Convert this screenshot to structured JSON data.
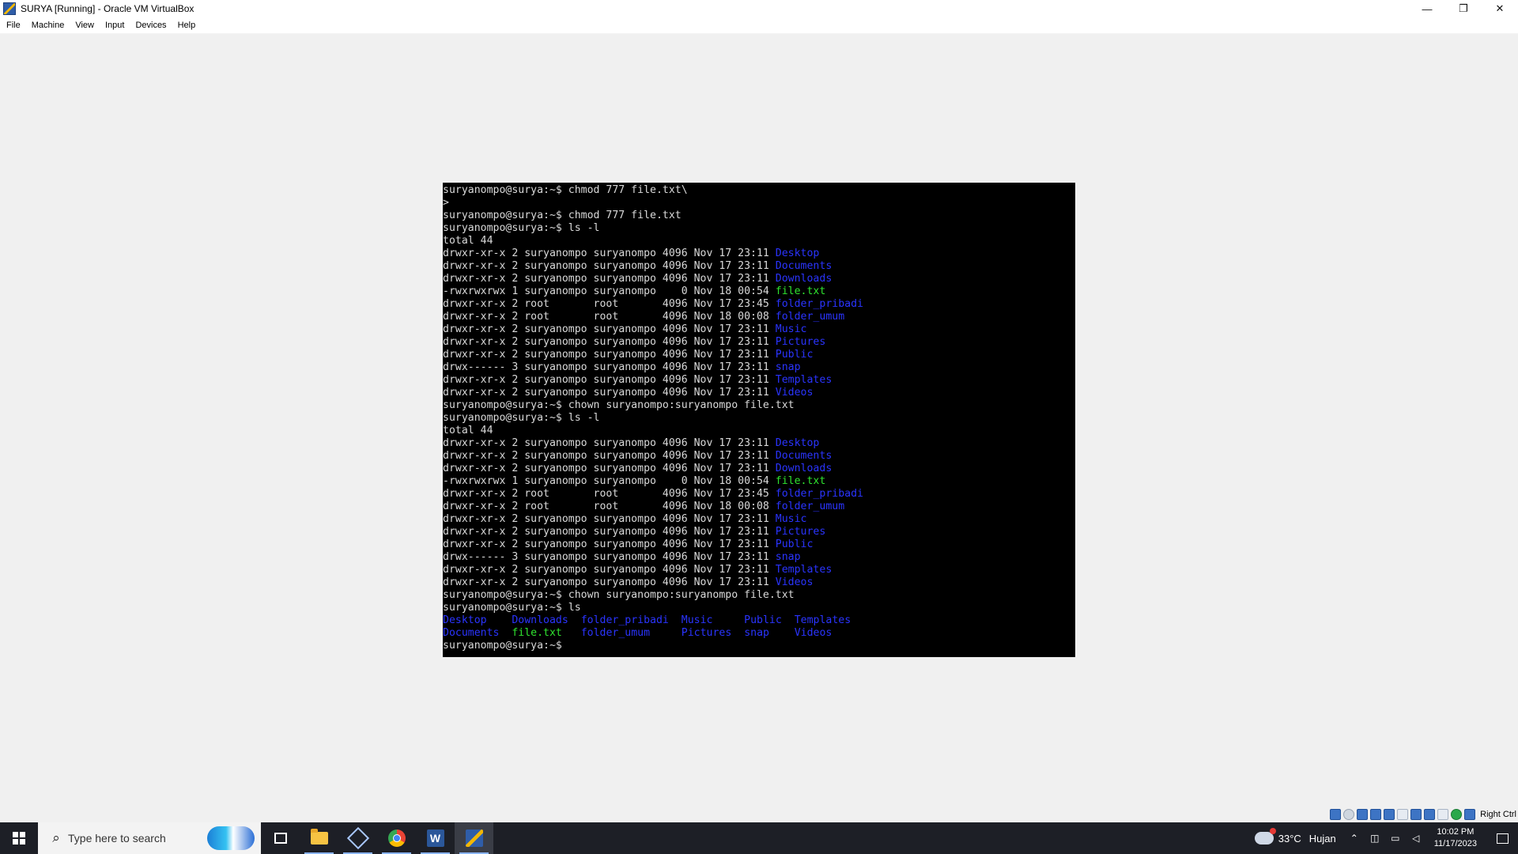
{
  "window": {
    "title": "SURYA [Running] - Oracle VM VirtualBox",
    "controls": {
      "minimize": "—",
      "restore": "❐",
      "close": "✕"
    }
  },
  "menu": [
    "File",
    "Machine",
    "View",
    "Input",
    "Devices",
    "Help"
  ],
  "terminal": {
    "lines": [
      [
        {
          "t": "suryanompo@surya:~$ chmod 777 file.txt\\"
        }
      ],
      [
        {
          "t": ">"
        }
      ],
      [
        {
          "t": "suryanompo@surya:~$ chmod 777 file.txt"
        }
      ],
      [
        {
          "t": "suryanompo@surya:~$ ls -l"
        }
      ],
      [
        {
          "t": "total 44"
        }
      ],
      [
        {
          "t": "drwxr-xr-x 2 suryanompo suryanompo 4096 Nov 17 23:11 "
        },
        {
          "t": "Desktop",
          "c": "dir"
        }
      ],
      [
        {
          "t": "drwxr-xr-x 2 suryanompo suryanompo 4096 Nov 17 23:11 "
        },
        {
          "t": "Documents",
          "c": "dir"
        }
      ],
      [
        {
          "t": "drwxr-xr-x 2 suryanompo suryanompo 4096 Nov 17 23:11 "
        },
        {
          "t": "Downloads",
          "c": "dir"
        }
      ],
      [
        {
          "t": "-rwxrwxrwx 1 suryanompo suryanompo    0 Nov 18 00:54 "
        },
        {
          "t": "file.txt",
          "c": "exec"
        }
      ],
      [
        {
          "t": "drwxr-xr-x 2 root       root       4096 Nov 17 23:45 "
        },
        {
          "t": "folder_pribadi",
          "c": "dir"
        }
      ],
      [
        {
          "t": "drwxr-xr-x 2 root       root       4096 Nov 18 00:08 "
        },
        {
          "t": "folder_umum",
          "c": "dir"
        }
      ],
      [
        {
          "t": "drwxr-xr-x 2 suryanompo suryanompo 4096 Nov 17 23:11 "
        },
        {
          "t": "Music",
          "c": "dir"
        }
      ],
      [
        {
          "t": "drwxr-xr-x 2 suryanompo suryanompo 4096 Nov 17 23:11 "
        },
        {
          "t": "Pictures",
          "c": "dir"
        }
      ],
      [
        {
          "t": "drwxr-xr-x 2 suryanompo suryanompo 4096 Nov 17 23:11 "
        },
        {
          "t": "Public",
          "c": "dir"
        }
      ],
      [
        {
          "t": "drwx------ 3 suryanompo suryanompo 4096 Nov 17 23:11 "
        },
        {
          "t": "snap",
          "c": "dir"
        }
      ],
      [
        {
          "t": "drwxr-xr-x 2 suryanompo suryanompo 4096 Nov 17 23:11 "
        },
        {
          "t": "Templates",
          "c": "dir"
        }
      ],
      [
        {
          "t": "drwxr-xr-x 2 suryanompo suryanompo 4096 Nov 17 23:11 "
        },
        {
          "t": "Videos",
          "c": "dir"
        }
      ],
      [
        {
          "t": "suryanompo@surya:~$ chown suryanompo:suryanompo file.txt"
        }
      ],
      [
        {
          "t": "suryanompo@surya:~$ ls -l"
        }
      ],
      [
        {
          "t": "total 44"
        }
      ],
      [
        {
          "t": "drwxr-xr-x 2 suryanompo suryanompo 4096 Nov 17 23:11 "
        },
        {
          "t": "Desktop",
          "c": "dir"
        }
      ],
      [
        {
          "t": "drwxr-xr-x 2 suryanompo suryanompo 4096 Nov 17 23:11 "
        },
        {
          "t": "Documents",
          "c": "dir"
        }
      ],
      [
        {
          "t": "drwxr-xr-x 2 suryanompo suryanompo 4096 Nov 17 23:11 "
        },
        {
          "t": "Downloads",
          "c": "dir"
        }
      ],
      [
        {
          "t": "-rwxrwxrwx 1 suryanompo suryanompo    0 Nov 18 00:54 "
        },
        {
          "t": "file.txt",
          "c": "exec"
        }
      ],
      [
        {
          "t": "drwxr-xr-x 2 root       root       4096 Nov 17 23:45 "
        },
        {
          "t": "folder_pribadi",
          "c": "dir"
        }
      ],
      [
        {
          "t": "drwxr-xr-x 2 root       root       4096 Nov 18 00:08 "
        },
        {
          "t": "folder_umum",
          "c": "dir"
        }
      ],
      [
        {
          "t": "drwxr-xr-x 2 suryanompo suryanompo 4096 Nov 17 23:11 "
        },
        {
          "t": "Music",
          "c": "dir"
        }
      ],
      [
        {
          "t": "drwxr-xr-x 2 suryanompo suryanompo 4096 Nov 17 23:11 "
        },
        {
          "t": "Pictures",
          "c": "dir"
        }
      ],
      [
        {
          "t": "drwxr-xr-x 2 suryanompo suryanompo 4096 Nov 17 23:11 "
        },
        {
          "t": "Public",
          "c": "dir"
        }
      ],
      [
        {
          "t": "drwx------ 3 suryanompo suryanompo 4096 Nov 17 23:11 "
        },
        {
          "t": "snap",
          "c": "dir"
        }
      ],
      [
        {
          "t": "drwxr-xr-x 2 suryanompo suryanompo 4096 Nov 17 23:11 "
        },
        {
          "t": "Templates",
          "c": "dir"
        }
      ],
      [
        {
          "t": "drwxr-xr-x 2 suryanompo suryanompo 4096 Nov 17 23:11 "
        },
        {
          "t": "Videos",
          "c": "dir"
        }
      ],
      [
        {
          "t": "suryanompo@surya:~$ chown suryanompo:suryanompo file.txt"
        }
      ],
      [
        {
          "t": "suryanompo@surya:~$ ls"
        }
      ],
      [
        {
          "t": "Desktop",
          "c": "dir"
        },
        {
          "t": "    "
        },
        {
          "t": "Downloads",
          "c": "dir"
        },
        {
          "t": "  "
        },
        {
          "t": "folder_pribadi",
          "c": "dir"
        },
        {
          "t": "  "
        },
        {
          "t": "Music",
          "c": "dir"
        },
        {
          "t": "     "
        },
        {
          "t": "Public",
          "c": "dir"
        },
        {
          "t": "  "
        },
        {
          "t": "Templates",
          "c": "dir"
        }
      ],
      [
        {
          "t": "Documents",
          "c": "dir"
        },
        {
          "t": "  "
        },
        {
          "t": "file.txt",
          "c": "exec"
        },
        {
          "t": "   "
        },
        {
          "t": "folder_umum",
          "c": "dir"
        },
        {
          "t": "     "
        },
        {
          "t": "Pictures",
          "c": "dir"
        },
        {
          "t": "  "
        },
        {
          "t": "snap",
          "c": "dir"
        },
        {
          "t": "    "
        },
        {
          "t": "Videos",
          "c": "dir"
        }
      ],
      [
        {
          "t": "suryanompo@surya:~$ "
        }
      ]
    ]
  },
  "statusbar": {
    "icons": [
      "hard-disk-icon",
      "optical-drive-icon",
      "audio-icon",
      "network-icon",
      "usb-icon",
      "shared-folder-icon",
      "display-icon",
      "recording-icon",
      "cpu-icon",
      "mouse-integration-icon",
      "keyboard-icon"
    ],
    "host_key": "Right Ctrl"
  },
  "taskbar": {
    "search_placeholder": "Type here to search",
    "apps": [
      "task-view",
      "file-explorer",
      "virtualbox-manager",
      "chrome",
      "word",
      "virtualbox-vm"
    ],
    "weather_temp": "33°C",
    "weather_text": "Hujan",
    "time": "10:02 PM",
    "date": "11/17/2023"
  }
}
